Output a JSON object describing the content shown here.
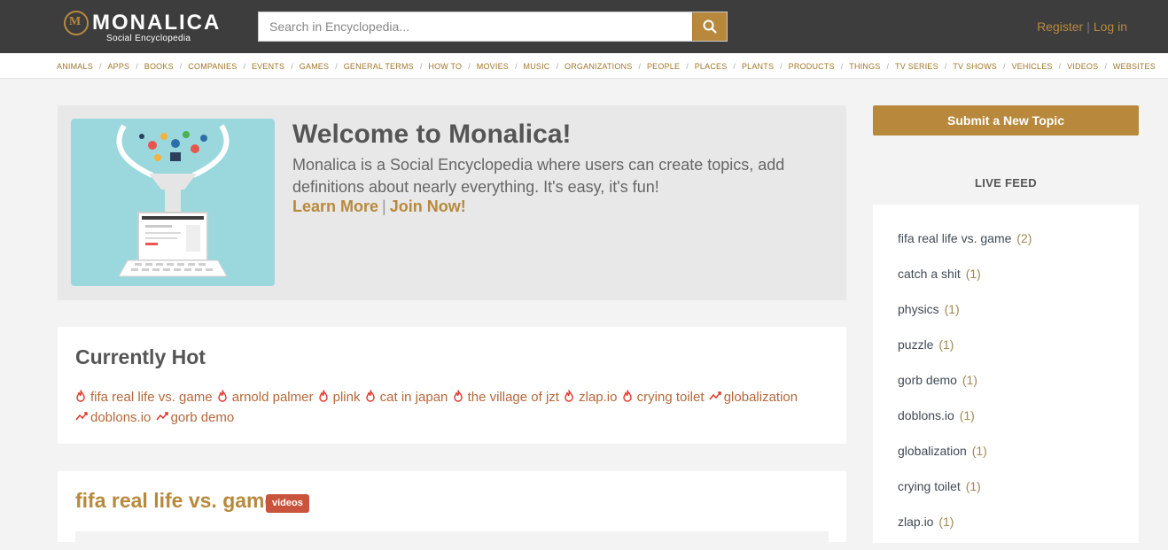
{
  "header": {
    "logo_title": "MONALICA",
    "logo_subtitle": "Social Encyclopedia",
    "search_placeholder": "Search in Encyclopedia...",
    "register": "Register",
    "separator": "|",
    "login": "Log in"
  },
  "categories": [
    "ANIMALS",
    "APPS",
    "BOOKS",
    "COMPANIES",
    "EVENTS",
    "GAMES",
    "GENERAL TERMS",
    "HOW TO",
    "MOVIES",
    "MUSIC",
    "ORGANIZATIONS",
    "PEOPLE",
    "PLACES",
    "PLANTS",
    "PRODUCTS",
    "THINGS",
    "TV SERIES",
    "TV SHOWS",
    "VEHICLES",
    "VIDEOS",
    "WEBSITES"
  ],
  "welcome": {
    "title": "Welcome to Monalica!",
    "text": "Monalica is a Social Encyclopedia where users can create topics, add definitions about nearly everything. It's easy, it's fun!",
    "learn_more": "Learn More",
    "separator": "|",
    "join_now": "Join Now!"
  },
  "hot": {
    "title": "Currently Hot",
    "items": [
      {
        "label": "fifa real life vs. game",
        "icon": "flame-icon"
      },
      {
        "label": "arnold palmer",
        "icon": "flame-icon"
      },
      {
        "label": "plink",
        "icon": "flame-icon"
      },
      {
        "label": "cat in japan",
        "icon": "flame-icon"
      },
      {
        "label": "the village of jzt",
        "icon": "flame-icon"
      },
      {
        "label": "zlap.io",
        "icon": "flame-icon"
      },
      {
        "label": "crying toilet",
        "icon": "flame-icon"
      },
      {
        "label": "globalization",
        "icon": "trending-icon"
      },
      {
        "label": "doblons.io",
        "icon": "trending-icon"
      },
      {
        "label": "gorb demo",
        "icon": "trending-icon"
      }
    ]
  },
  "topic": {
    "title": "fifa real life vs. game",
    "badge": "videos"
  },
  "sidebar": {
    "submit_label": "Submit a New Topic",
    "feed_title": "LIVE FEED",
    "feed": [
      {
        "label": "fifa real life vs. game",
        "count": "(2)"
      },
      {
        "label": "catch a shit",
        "count": "(1)"
      },
      {
        "label": "physics",
        "count": "(1)"
      },
      {
        "label": "puzzle",
        "count": "(1)"
      },
      {
        "label": "gorb demo",
        "count": "(1)"
      },
      {
        "label": "doblons.io",
        "count": "(1)"
      },
      {
        "label": "globalization",
        "count": "(1)"
      },
      {
        "label": "crying toilet",
        "count": "(1)"
      },
      {
        "label": "zlap.io",
        "count": "(1)"
      }
    ]
  },
  "colors": {
    "header_bg": "#3d3d3d",
    "accent": "#b8893c",
    "hot_link": "#b5683a",
    "badge": "#c9543e"
  }
}
